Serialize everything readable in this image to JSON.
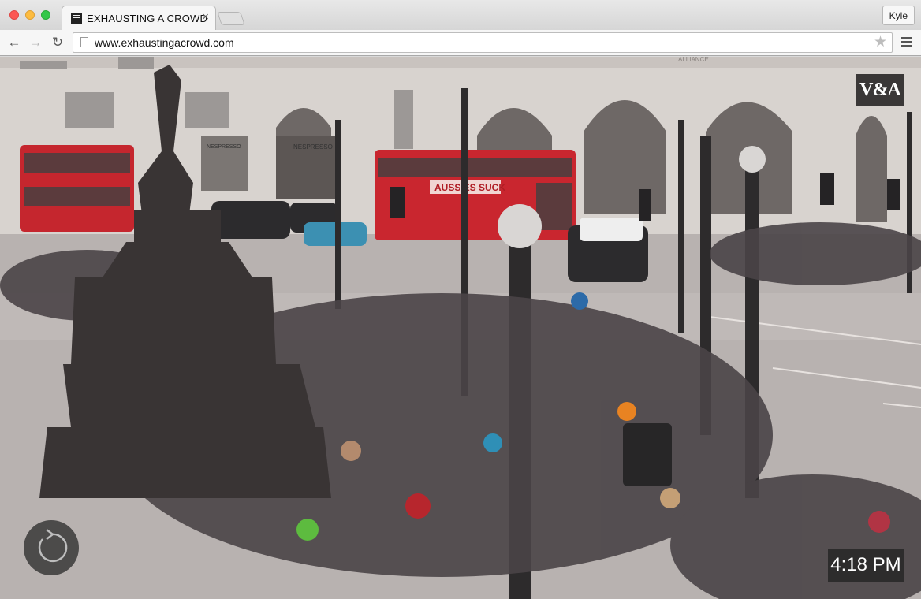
{
  "browser": {
    "tab_title": "EXHAUSTING A CROWD",
    "tab_close": "×",
    "profile_name": "Kyle",
    "url": "www.exhaustingacrowd.com"
  },
  "nav": {
    "back_glyph": "←",
    "forward_glyph": "→",
    "reload_glyph": "↻",
    "star_glyph": "★"
  },
  "overlay": {
    "logo_text": "V&A",
    "time": "4:18 PM"
  },
  "scene": {
    "bus_ad_text": "AUSSIES SUCK",
    "shop_sign_1": "NESPRESSO",
    "shop_sign_2": "NESPRESSO",
    "building_text": "ALLIANCE"
  },
  "colors": {
    "bus_red": "#c8262f",
    "building": "#d6d2cd",
    "road": "#b9b4b2",
    "statue": "#3a3535"
  }
}
